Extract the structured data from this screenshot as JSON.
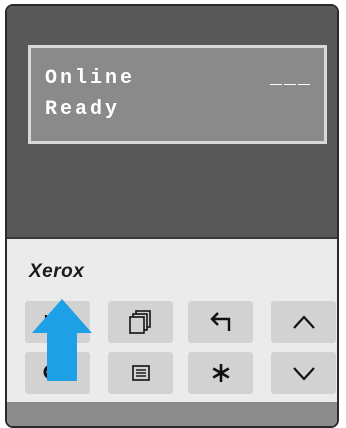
{
  "display": {
    "line1": "Online",
    "line2": "Ready",
    "status_indicator": "___"
  },
  "brand": {
    "name": "Xerox"
  },
  "keypad": {
    "keys": [
      {
        "name": "back-key",
        "icon": "back-arrow-icon"
      },
      {
        "name": "copy-key",
        "icon": "pages-icon"
      },
      {
        "name": "return-key",
        "icon": "return-arrow-icon"
      },
      {
        "name": "up-key",
        "icon": "chevron-up-icon"
      },
      {
        "name": "home-key",
        "icon": "reset-icon"
      },
      {
        "name": "menu-key",
        "icon": "menu-list-icon"
      },
      {
        "name": "star-key",
        "icon": "asterisk-icon"
      },
      {
        "name": "down-key",
        "icon": "chevron-down-icon"
      }
    ]
  },
  "colors": {
    "screen_bg": "#585858",
    "lcd_bg": "#8a8a8a",
    "key_bg": "#d2d2d2",
    "pointer": "#1ea0e6"
  }
}
